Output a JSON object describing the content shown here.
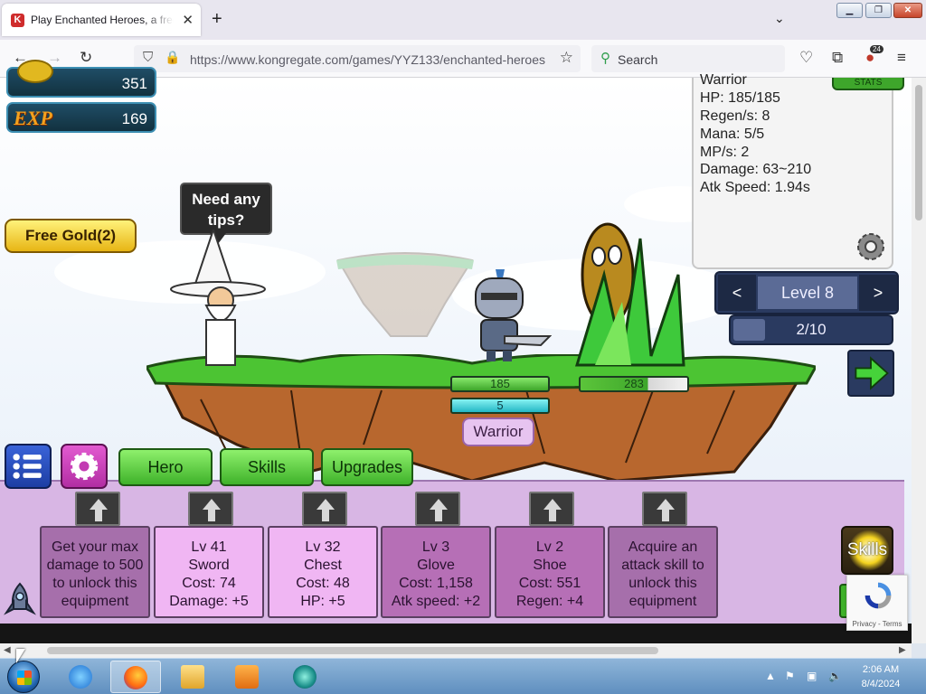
{
  "browser": {
    "tab_title": "Play Enchanted Heroes, a free online game on Kongregate",
    "tab_favicon": "K",
    "url": "https://www.kongregate.com/games/YYZ133/enchanted-heroes",
    "search_placeholder": "Search",
    "extension_badge": "24"
  },
  "hud": {
    "gold": "351",
    "exp_label": "EXP",
    "exp": "169",
    "free_gold": "Free Gold(2)"
  },
  "tip": {
    "text_line1": "Need any",
    "text_line2": "tips?"
  },
  "battle": {
    "hero_hp": "185",
    "hero_mp": "5",
    "hero_name": "Warrior",
    "enemy_hp": "283",
    "enemy_hp_fraction": 0.63
  },
  "stats_panel": {
    "lines": [
      "Warrior",
      "HP: 185/185",
      "Regen/s: 8",
      "Mana: 5/5",
      "MP/s: 2",
      "Damage: 63~210",
      "Atk Speed: 1.94s"
    ],
    "tab_label": "STATS"
  },
  "level_nav": {
    "prev": "<",
    "label": "Level 8",
    "next": ">",
    "wave": "2/10",
    "wave_fraction": 0.2
  },
  "bottom_tabs": {
    "hero": "Hero",
    "skills": "Skills",
    "upgrades": "Upgrades"
  },
  "equipment": [
    {
      "lines": [
        "Get your max",
        "damage to 500",
        "to unlock this",
        "equipment"
      ],
      "state": "locked"
    },
    {
      "lines": [
        "Lv 41",
        "Sword",
        "Cost: 74",
        "Damage: +5"
      ],
      "state": "owned"
    },
    {
      "lines": [
        "Lv 32",
        "Chest",
        "Cost: 48",
        "HP: +5"
      ],
      "state": "owned"
    },
    {
      "lines": [
        "Lv 3",
        "Glove",
        "Cost: 1,158",
        "Atk speed: +2"
      ],
      "state": "partial"
    },
    {
      "lines": [
        "Lv 2",
        "Shoe",
        "Cost: 551",
        "Regen: +4"
      ],
      "state": "partial"
    },
    {
      "lines": [
        "Acquire an",
        "attack skill to",
        "unlock this",
        "equipment"
      ],
      "state": "locked"
    }
  ],
  "skills_button": "Skills",
  "recaptcha": "Privacy - Terms",
  "taskbar": {
    "time": "2:06 AM",
    "date": "8/4/2024"
  },
  "colors": {
    "panel_purple": "#d8b6e4",
    "button_green": "#3fb22a",
    "level_navy": "#2a3a60"
  }
}
